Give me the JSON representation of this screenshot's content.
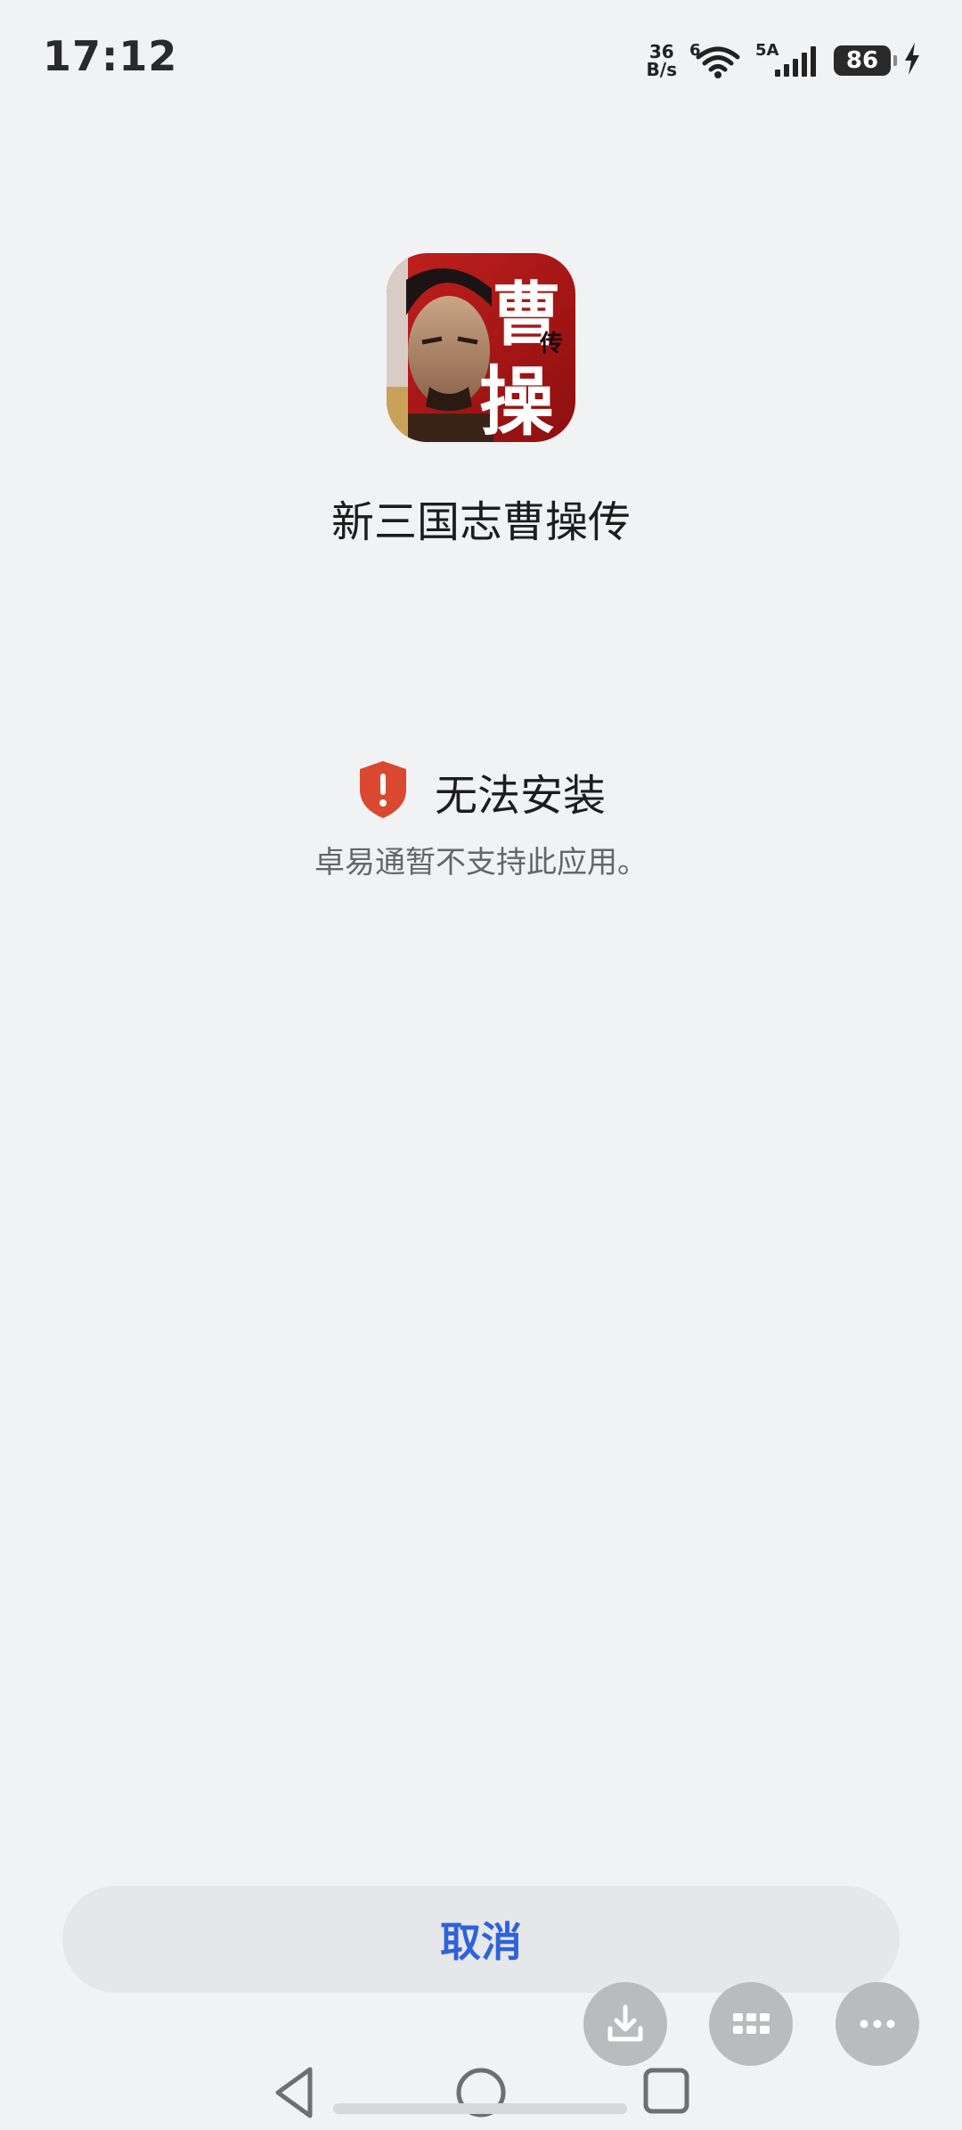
{
  "status_bar": {
    "time": "17:12",
    "net_speed_value": "36",
    "net_speed_unit": "B/s",
    "wifi_label": "6",
    "signal_label": "5A",
    "battery_level": "86"
  },
  "app": {
    "name": "新三国志曹操传",
    "icon_text_1": "曹",
    "icon_text_2": "操",
    "icon_text_3": "传"
  },
  "error": {
    "title": "无法安装",
    "message": "卓易通暂不支持此应用。"
  },
  "actions": {
    "cancel_label": "取消"
  },
  "colors": {
    "background": "#f1f2f4",
    "accent": "#2f62d8",
    "warning": "#d9482f"
  }
}
